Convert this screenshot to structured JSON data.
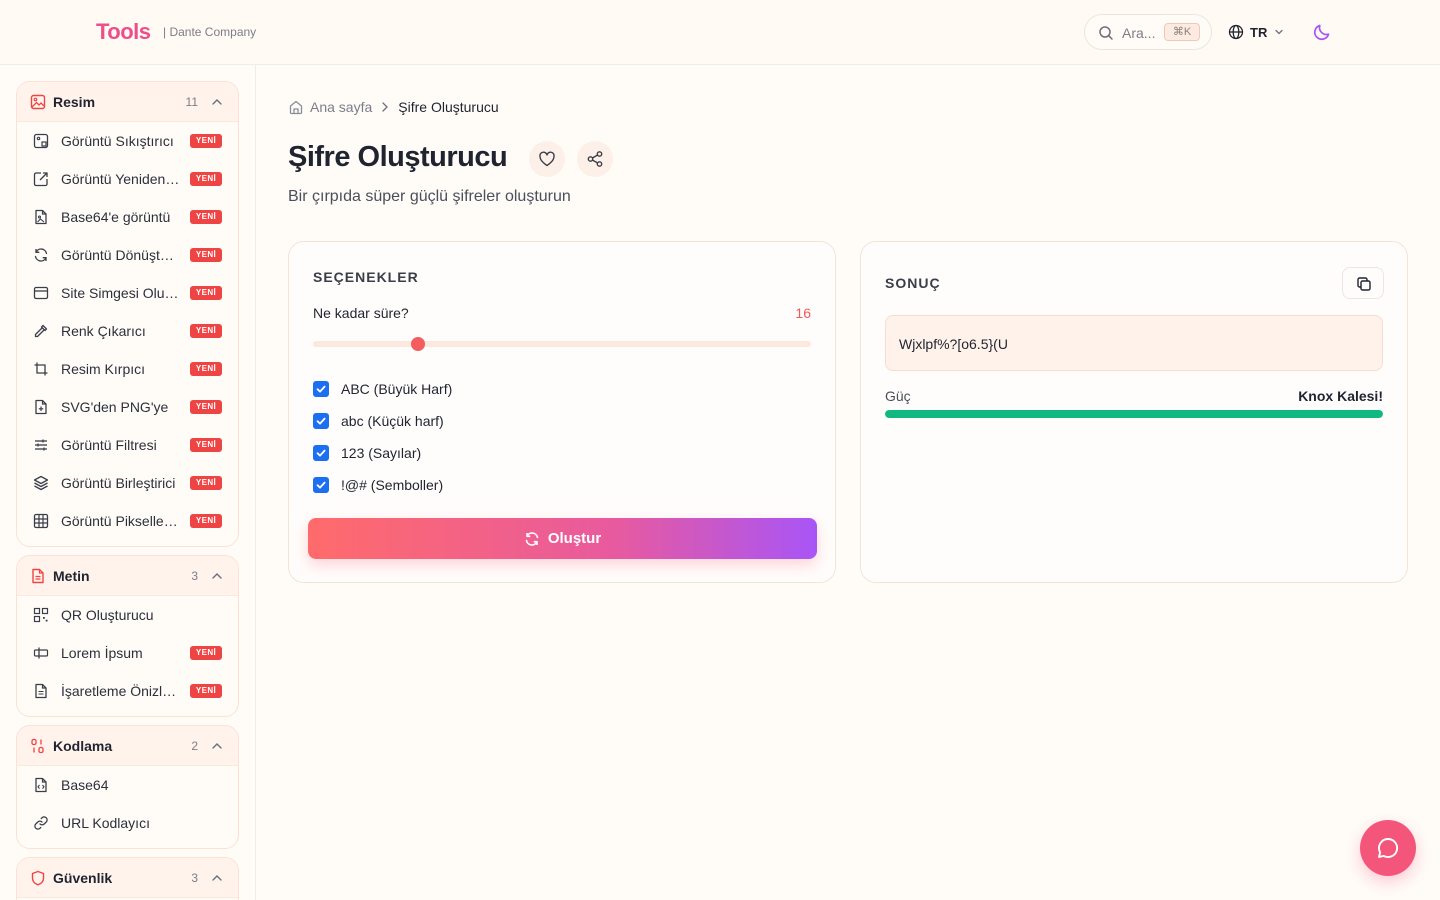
{
  "header": {
    "logo": "Tools",
    "company": "| Dante Company",
    "search_placeholder": "Ara...",
    "search_shortcut": "⌘K",
    "language": "TR"
  },
  "sidebar": {
    "groups": [
      {
        "title": "Resim",
        "count": "11",
        "items": [
          {
            "label": "Görüntü Sıkıştırıcı",
            "badge": "YENİ"
          },
          {
            "label": "Görüntü Yeniden Boyutlandırıcı",
            "badge": "YENİ"
          },
          {
            "label": "Base64'e görüntü",
            "badge": "YENİ"
          },
          {
            "label": "Görüntü Dönüştürücü",
            "badge": "YENİ"
          },
          {
            "label": "Site Simgesi Oluşturucu",
            "badge": "YENİ"
          },
          {
            "label": "Renk Çıkarıcı",
            "badge": "YENİ"
          },
          {
            "label": "Resim Kırpıcı",
            "badge": "YENİ"
          },
          {
            "label": "SVG'den PNG'ye",
            "badge": "YENİ"
          },
          {
            "label": "Görüntü Filtresi",
            "badge": "YENİ"
          },
          {
            "label": "Görüntü Birleştirici",
            "badge": "YENİ"
          },
          {
            "label": "Görüntü Pikselleştirici",
            "badge": "YENİ"
          }
        ]
      },
      {
        "title": "Metin",
        "count": "3",
        "items": [
          {
            "label": "QR Oluşturucu"
          },
          {
            "label": "Lorem İpsum",
            "badge": "YENİ"
          },
          {
            "label": "İşaretleme Önizleyici",
            "badge": "YENİ"
          }
        ]
      },
      {
        "title": "Kodlama",
        "count": "2",
        "items": [
          {
            "label": "Base64"
          },
          {
            "label": "URL Kodlayıcı"
          }
        ]
      },
      {
        "title": "Güvenlik",
        "count": "3",
        "items": []
      }
    ]
  },
  "main": {
    "breadcrumb_home": "Ana sayfa",
    "breadcrumb_current": "Şifre Oluşturucu",
    "title": "Şifre Oluşturucu",
    "subtitle": "Bir çırpıda süper güçlü şifreler oluşturun"
  },
  "options": {
    "section_title": "SEÇENEKLER",
    "length_label": "Ne kadar süre?",
    "length_value": "16",
    "length_fraction": 0.21,
    "checkboxes": [
      {
        "label": "ABC (Büyük Harf)",
        "checked": true
      },
      {
        "label": "abc (Küçük harf)",
        "checked": true
      },
      {
        "label": "123 (Sayılar)",
        "checked": true
      },
      {
        "label": "!@# (Semboller)",
        "checked": true
      }
    ],
    "generate_label": "Oluştur"
  },
  "result": {
    "section_title": "SONUÇ",
    "password": "Wjxlpf%?[o6.5}(U",
    "strength_label": "Güç",
    "strength_value": "Knox Kalesi!",
    "strength_fraction": 1.0
  },
  "colors": {
    "brand": "#ec4f8a",
    "accent": "#f45d5d",
    "badge": "#ef4444",
    "checkbox": "#1d6ff2",
    "strength": "#10b981"
  }
}
